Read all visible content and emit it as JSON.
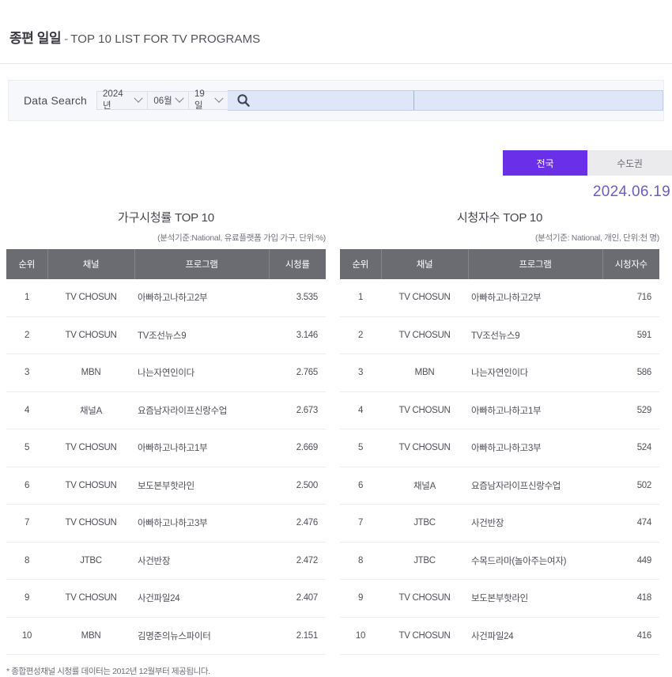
{
  "header": {
    "title_ko": "종편 일일",
    "dash": "-",
    "title_en": "TOP 10 LIST FOR TV PROGRAMS"
  },
  "search": {
    "label": "Data Search",
    "year": "2024년",
    "month": "06월",
    "day": "19일",
    "query_value": "",
    "placeholder": "",
    "icon": "search-icon"
  },
  "region_tabs": {
    "active_label": "전국",
    "inactive_label": "수도권",
    "active_color": "#6a2fe8",
    "inactive_color": "#ebebee"
  },
  "selected_date": "2024.06.19",
  "accent_color": "#7b68c8",
  "boards": [
    {
      "title": "가구시청률 TOP 10",
      "subtitle": "(분석기준:National, 유료플랫폼 가입 가구, 단위:%)",
      "columns": [
        "순위",
        "채널",
        "프로그램",
        "시청률"
      ],
      "rows": [
        {
          "rank": "1",
          "channel": "TV CHOSUN",
          "program": "아빠하고나하고2부",
          "value": "3.535"
        },
        {
          "rank": "2",
          "channel": "TV CHOSUN",
          "program": "TV조선뉴스9",
          "value": "3.146"
        },
        {
          "rank": "3",
          "channel": "MBN",
          "program": "나는자연인이다",
          "value": "2.765"
        },
        {
          "rank": "4",
          "channel": "채널A",
          "program": "요즘남자라이프신랑수업",
          "value": "2.673"
        },
        {
          "rank": "5",
          "channel": "TV CHOSUN",
          "program": "아빠하고나하고1부",
          "value": "2.669"
        },
        {
          "rank": "6",
          "channel": "TV CHOSUN",
          "program": "보도본부핫라인",
          "value": "2.500"
        },
        {
          "rank": "7",
          "channel": "TV CHOSUN",
          "program": "아빠하고나하고3부",
          "value": "2.476"
        },
        {
          "rank": "8",
          "channel": "JTBC",
          "program": "사건반장",
          "value": "2.472"
        },
        {
          "rank": "9",
          "channel": "TV CHOSUN",
          "program": "사건파일24",
          "value": "2.407"
        },
        {
          "rank": "10",
          "channel": "MBN",
          "program": "김명준의뉴스파이터",
          "value": "2.151"
        }
      ],
      "footnote": "* 종합편성채널 시청률 데이터는 2012년 12월부터 제공됩니다."
    },
    {
      "title": "시청자수 TOP 10",
      "subtitle": "(분석기준: National, 개인, 단위:천 명)",
      "columns": [
        "순위",
        "채널",
        "프로그램",
        "시청자수"
      ],
      "rows": [
        {
          "rank": "1",
          "channel": "TV CHOSUN",
          "program": "아빠하고나하고2부",
          "value": "716"
        },
        {
          "rank": "2",
          "channel": "TV CHOSUN",
          "program": "TV조선뉴스9",
          "value": "591"
        },
        {
          "rank": "3",
          "channel": "MBN",
          "program": "나는자연인이다",
          "value": "586"
        },
        {
          "rank": "4",
          "channel": "TV CHOSUN",
          "program": "아빠하고나하고1부",
          "value": "529"
        },
        {
          "rank": "5",
          "channel": "TV CHOSUN",
          "program": "아빠하고나하고3부",
          "value": "524"
        },
        {
          "rank": "6",
          "channel": "채널A",
          "program": "요즘남자라이프신랑수업",
          "value": "502"
        },
        {
          "rank": "7",
          "channel": "JTBC",
          "program": "사건반장",
          "value": "474"
        },
        {
          "rank": "8",
          "channel": "JTBC",
          "program": "수목드라마(놀아주는여자)",
          "value": "449"
        },
        {
          "rank": "9",
          "channel": "TV CHOSUN",
          "program": "보도본부핫라인",
          "value": "418"
        },
        {
          "rank": "10",
          "channel": "TV CHOSUN",
          "program": "사건파일24",
          "value": "416"
        }
      ],
      "footnote": ""
    }
  ]
}
